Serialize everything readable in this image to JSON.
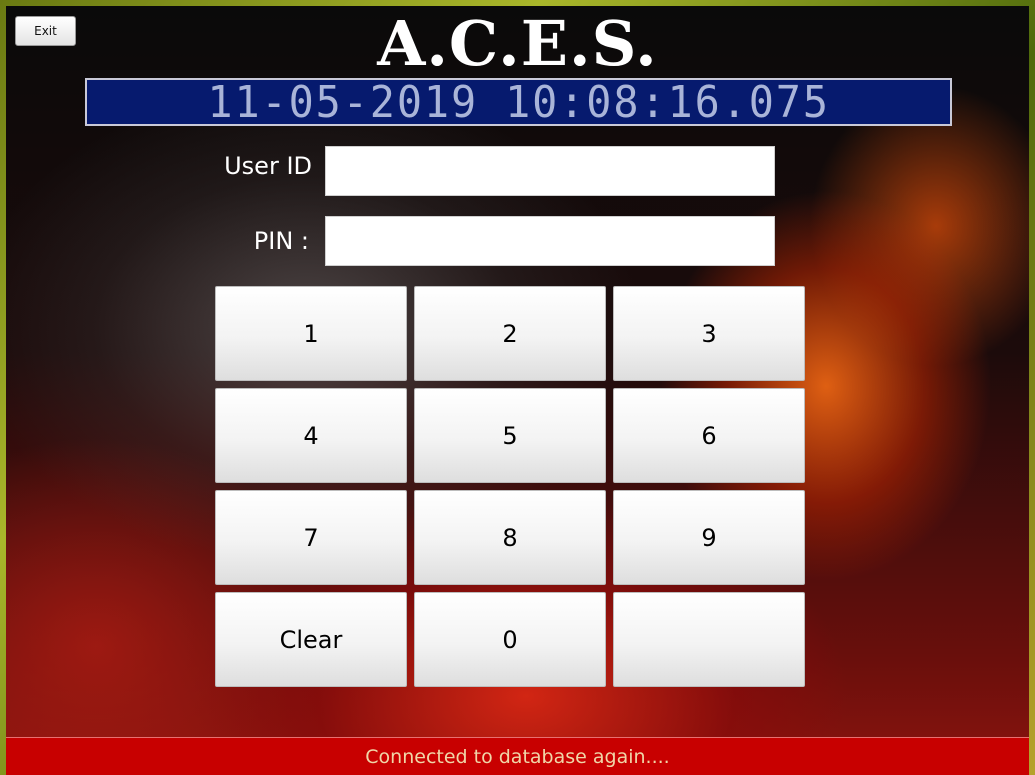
{
  "app": {
    "title": "A.C.E.S.",
    "exit_label": "Exit"
  },
  "clock": {
    "display": "11-05-2019  10:08:16.075"
  },
  "login": {
    "user_id_label": "User ID",
    "user_id_value": "",
    "pin_label": "PIN :",
    "pin_value": ""
  },
  "keypad": {
    "keys": [
      "1",
      "2",
      "3",
      "4",
      "5",
      "6",
      "7",
      "8",
      "9",
      "Clear",
      "0",
      ""
    ]
  },
  "status": {
    "message": "Connected to database again....",
    "color": "#c80000"
  }
}
